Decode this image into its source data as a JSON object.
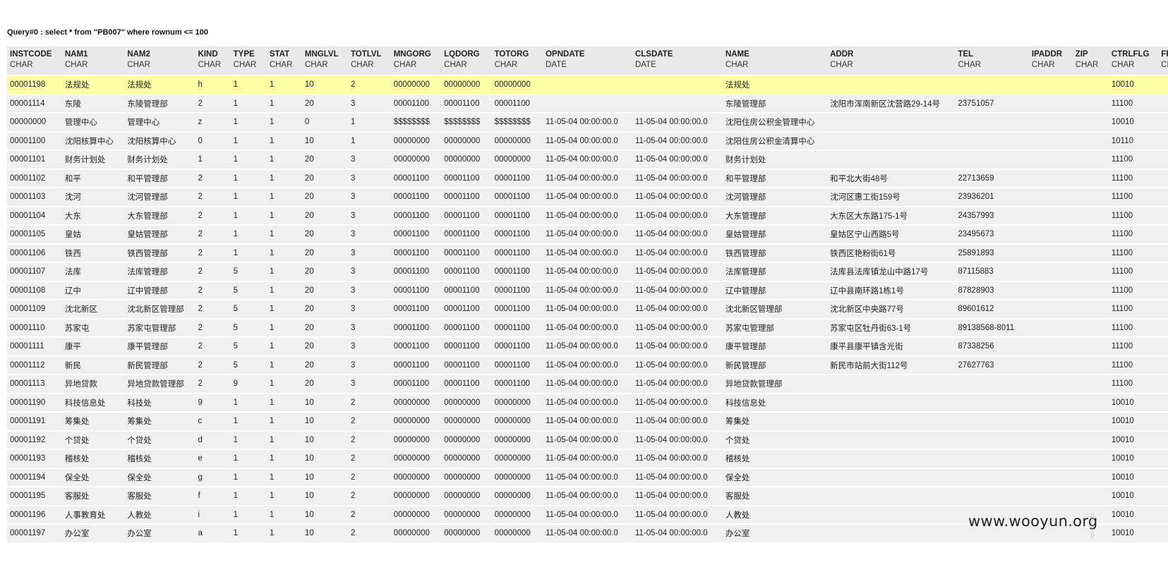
{
  "query": {
    "title": "Query#0 : select * from \"PB007\" where rownum <= 100"
  },
  "table": {
    "columns": [
      {
        "name": "INSTCODE",
        "type": "CHAR"
      },
      {
        "name": "NAM1",
        "type": "CHAR"
      },
      {
        "name": "NAM2",
        "type": "CHAR"
      },
      {
        "name": "KIND",
        "type": "CHAR"
      },
      {
        "name": "TYPE",
        "type": "CHAR"
      },
      {
        "name": "STAT",
        "type": "CHAR"
      },
      {
        "name": "MNGLVL",
        "type": "CHAR"
      },
      {
        "name": "TOTLVL",
        "type": "CHAR"
      },
      {
        "name": "MNGORG",
        "type": "CHAR"
      },
      {
        "name": "LQDORG",
        "type": "CHAR"
      },
      {
        "name": "TOTORG",
        "type": "CHAR"
      },
      {
        "name": "OPNDATE",
        "type": "DATE"
      },
      {
        "name": "CLSDATE",
        "type": "DATE"
      },
      {
        "name": "NAME",
        "type": "CHAR"
      },
      {
        "name": "ADDR",
        "type": "CHAR"
      },
      {
        "name": "TEL",
        "type": "CHAR"
      },
      {
        "name": "IPADDR",
        "type": "CHAR"
      },
      {
        "name": "ZIP",
        "type": "CHAR"
      },
      {
        "name": "CTRLFLG",
        "type": "CHAR"
      },
      {
        "name": "FREE",
        "type": "CHAR"
      }
    ],
    "rows": [
      [
        "00001198",
        "法规处",
        "法规处",
        "h",
        "1",
        "1",
        "10",
        "2",
        "00000000",
        "00000000",
        "00000000",
        "",
        "",
        "法规处",
        "",
        "",
        "",
        "",
        "10010",
        ""
      ],
      [
        "00001114",
        "东陵",
        "东陵管理部",
        "2",
        "1",
        "1",
        "20",
        "3",
        "00001100",
        "00001100",
        "00001100",
        "",
        "",
        "东陵管理部",
        "沈阳市浑南新区沈营路29-14号",
        "23751057",
        "",
        "",
        "11100",
        ""
      ],
      [
        "00000000",
        "管理中心",
        "管理中心",
        "z",
        "1",
        "1",
        "0",
        "1",
        "$$$$$$$$",
        "$$$$$$$$",
        "$$$$$$$$",
        "11-05-04 00:00:00.0",
        "11-05-04 00:00:00.0",
        "沈阳住房公积金管理中心",
        "",
        "",
        "",
        "",
        "10010",
        ""
      ],
      [
        "00001100",
        "沈阳核算中心",
        "沈阳核算中心",
        "0",
        "1",
        "1",
        "10",
        "1",
        "00000000",
        "00000000",
        "00000000",
        "11-05-04 00:00:00.0",
        "11-05-04 00:00:00.0",
        "沈阳住房公积金清算中心",
        "",
        "",
        "",
        "",
        "10110",
        ""
      ],
      [
        "00001101",
        "财务计划处",
        "财务计划处",
        "1",
        "1",
        "1",
        "20",
        "3",
        "00000000",
        "00000000",
        "00000000",
        "11-05-04 00:00:00.0",
        "11-05-04 00:00:00.0",
        "财务计划处",
        "",
        "",
        "",
        "",
        "11100",
        ""
      ],
      [
        "00001102",
        "和平",
        "和平管理部",
        "2",
        "1",
        "1",
        "20",
        "3",
        "00001100",
        "00001100",
        "00001100",
        "11-05-04 00:00:00.0",
        "11-05-04 00:00:00.0",
        "和平管理部",
        "和平北大街48号",
        "22713659",
        "",
        "",
        "11100",
        ""
      ],
      [
        "00001103",
        "沈河",
        "沈河管理部",
        "2",
        "1",
        "1",
        "20",
        "3",
        "00001100",
        "00001100",
        "00001100",
        "11-05-04 00:00:00.0",
        "11-05-04 00:00:00.0",
        "沈河管理部",
        "沈河区惠工街159号",
        "23936201",
        "",
        "",
        "11100",
        ""
      ],
      [
        "00001104",
        "大东",
        "大东管理部",
        "2",
        "1",
        "1",
        "20",
        "3",
        "00001100",
        "00001100",
        "00001100",
        "11-05-04 00:00:00.0",
        "11-05-04 00:00:00.0",
        "大东管理部",
        "大东区大东路175-1号",
        "24357993",
        "",
        "",
        "11100",
        ""
      ],
      [
        "00001105",
        "皇姑",
        "皇姑管理部",
        "2",
        "1",
        "1",
        "20",
        "3",
        "00001100",
        "00001100",
        "00001100",
        "11-05-04 00:00:00.0",
        "11-05-04 00:00:00.0",
        "皇姑管理部",
        "皇姑区宁山西路5号",
        "23495673",
        "",
        "",
        "11100",
        ""
      ],
      [
        "00001106",
        "铁西",
        "铁西管理部",
        "2",
        "1",
        "1",
        "20",
        "3",
        "00001100",
        "00001100",
        "00001100",
        "11-05-04 00:00:00.0",
        "11-05-04 00:00:00.0",
        "铁西管理部",
        "铁西区艳粉街61号",
        "25891893",
        "",
        "",
        "11100",
        ""
      ],
      [
        "00001107",
        "法库",
        "法库管理部",
        "2",
        "5",
        "1",
        "20",
        "3",
        "00001100",
        "00001100",
        "00001100",
        "11-05-04 00:00:00.0",
        "11-05-04 00:00:00.0",
        "法库管理部",
        "法库县法库镇龙山中路17号",
        "87115883",
        "",
        "",
        "11100",
        ""
      ],
      [
        "00001108",
        "辽中",
        "辽中管理部",
        "2",
        "5",
        "1",
        "20",
        "3",
        "00001100",
        "00001100",
        "00001100",
        "11-05-04 00:00:00.0",
        "11-05-04 00:00:00.0",
        "辽中管理部",
        "辽中县南环路1栋1号",
        "87828903",
        "",
        "",
        "11100",
        ""
      ],
      [
        "00001109",
        "沈北新区",
        "沈北新区管理部",
        "2",
        "5",
        "1",
        "20",
        "3",
        "00001100",
        "00001100",
        "00001100",
        "11-05-04 00:00:00.0",
        "11-05-04 00:00:00.0",
        "沈北新区管理部",
        "沈北新区中央路77号",
        "89601612",
        "",
        "",
        "11100",
        ""
      ],
      [
        "00001110",
        "苏家屯",
        "苏家屯管理部",
        "2",
        "5",
        "1",
        "20",
        "3",
        "00001100",
        "00001100",
        "00001100",
        "11-05-04 00:00:00.0",
        "11-05-04 00:00:00.0",
        "苏家屯管理部",
        "苏家屯区牡丹街63-1号",
        "89138568-8011",
        "",
        "",
        "11100",
        ""
      ],
      [
        "00001111",
        "康平",
        "康平管理部",
        "2",
        "5",
        "1",
        "20",
        "3",
        "00001100",
        "00001100",
        "00001100",
        "11-05-04 00:00:00.0",
        "11-05-04 00:00:00.0",
        "康平管理部",
        "康平县康平镇含光街",
        "87338256",
        "",
        "",
        "11100",
        ""
      ],
      [
        "00001112",
        "新民",
        "新民管理部",
        "2",
        "5",
        "1",
        "20",
        "3",
        "00001100",
        "00001100",
        "00001100",
        "11-05-04 00:00:00.0",
        "11-05-04 00:00:00.0",
        "新民管理部",
        "新民市站前大街112号",
        "27627763",
        "",
        "",
        "11100",
        ""
      ],
      [
        "00001113",
        "异地贷款",
        "异地贷款管理部",
        "2",
        "9",
        "1",
        "20",
        "3",
        "00001100",
        "00001100",
        "00001100",
        "11-05-04 00:00:00.0",
        "11-05-04 00:00:00.0",
        "异地贷款管理部",
        "",
        "",
        "",
        "",
        "11100",
        ""
      ],
      [
        "00001190",
        "科技信息处",
        "科技处",
        "9",
        "1",
        "1",
        "10",
        "2",
        "00000000",
        "00000000",
        "00000000",
        "11-05-04 00:00:00.0",
        "11-05-04 00:00:00.0",
        "科技信息处",
        "",
        "",
        "",
        "",
        "10010",
        ""
      ],
      [
        "00001191",
        "筹集处",
        "筹集处",
        "c",
        "1",
        "1",
        "10",
        "2",
        "00000000",
        "00000000",
        "00000000",
        "11-05-04 00:00:00.0",
        "11-05-04 00:00:00.0",
        "筹集处",
        "",
        "",
        "",
        "",
        "10010",
        ""
      ],
      [
        "00001192",
        "个贷处",
        "个贷处",
        "d",
        "1",
        "1",
        "10",
        "2",
        "00000000",
        "00000000",
        "00000000",
        "11-05-04 00:00:00.0",
        "11-05-04 00:00:00.0",
        "个贷处",
        "",
        "",
        "",
        "",
        "10010",
        ""
      ],
      [
        "00001193",
        "稽核处",
        "稽核处",
        "e",
        "1",
        "1",
        "10",
        "2",
        "00000000",
        "00000000",
        "00000000",
        "11-05-04 00:00:00.0",
        "11-05-04 00:00:00.0",
        "稽核处",
        "",
        "",
        "",
        "",
        "10010",
        ""
      ],
      [
        "00001194",
        "保全处",
        "保全处",
        "g",
        "1",
        "1",
        "10",
        "2",
        "00000000",
        "00000000",
        "00000000",
        "11-05-04 00:00:00.0",
        "11-05-04 00:00:00.0",
        "保全处",
        "",
        "",
        "",
        "",
        "10010",
        ""
      ],
      [
        "00001195",
        "客服处",
        "客服处",
        "f",
        "1",
        "1",
        "10",
        "2",
        "00000000",
        "00000000",
        "00000000",
        "11-05-04 00:00:00.0",
        "11-05-04 00:00:00.0",
        "客服处",
        "",
        "",
        "",
        "",
        "10010",
        ""
      ],
      [
        "00001196",
        "人事教育处",
        "人教处",
        "i",
        "1",
        "1",
        "10",
        "2",
        "00000000",
        "00000000",
        "00000000",
        "11-05-04 00:00:00.0",
        "11-05-04 00:00:00.0",
        "人教处",
        "",
        "",
        "",
        "",
        "10010",
        ""
      ],
      [
        "00001197",
        "办公室",
        "办公室",
        "a",
        "1",
        "1",
        "10",
        "2",
        "00000000",
        "00000000",
        "00000000",
        "11-05-04 00:00:00.0",
        "11-05-04 00:00:00.0",
        "办公室",
        "",
        "",
        "",
        "",
        "10010",
        ""
      ]
    ],
    "highlight_row": 0,
    "highlight_color": "#ffffa6"
  },
  "watermark": {
    "text": "www.wooyun.org"
  }
}
